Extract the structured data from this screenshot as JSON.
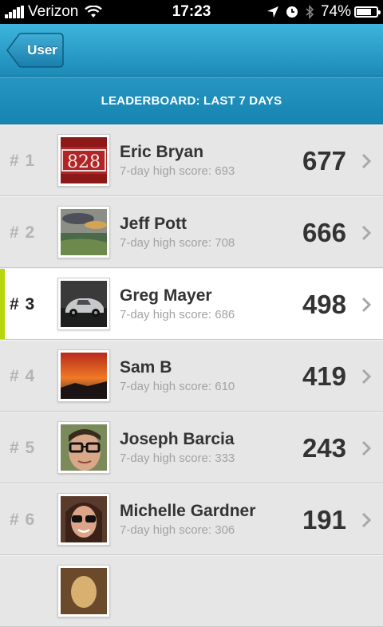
{
  "status_bar": {
    "carrier": "Verizon",
    "time": "17:23",
    "battery_percent": "74%",
    "battery_level": 0.74,
    "icons": [
      "signal-bars-icon",
      "wifi-icon",
      "location-arrow-icon",
      "alarm-clock-icon",
      "bluetooth-icon",
      "battery-icon"
    ]
  },
  "nav": {
    "back_label": "User"
  },
  "header": {
    "title": "LEADERBOARD: LAST 7 DAYS"
  },
  "colors": {
    "nav_blue": "#1c8ab7",
    "highlight": "#b6d80a",
    "row_bg": "#e6e6e6",
    "current_row_bg": "#ffffff"
  },
  "rows": [
    {
      "rank": "# 1",
      "name": "Eric Bryan",
      "subtext": "7-day high score: 693",
      "score": "677",
      "avatar": "car-plate-828",
      "current": false
    },
    {
      "rank": "# 2",
      "name": "Jeff Pott",
      "subtext": "7-day high score: 708",
      "score": "666",
      "avatar": "landscape-sunset",
      "current": false
    },
    {
      "rank": "# 3",
      "name": "Greg Mayer",
      "subtext": "7-day high score: 686",
      "score": "498",
      "avatar": "silver-sports-car",
      "current": true
    },
    {
      "rank": "# 4",
      "name": "Sam B",
      "subtext": "7-day high score: 610",
      "score": "419",
      "avatar": "orange-sky",
      "current": false
    },
    {
      "rank": "# 5",
      "name": "Joseph Barcia",
      "subtext": "7-day high score: 333",
      "score": "243",
      "avatar": "person-glasses",
      "current": false
    },
    {
      "rank": "# 6",
      "name": "Michelle Gardner",
      "subtext": "7-day high score: 306",
      "score": "191",
      "avatar": "person-sunglasses",
      "current": false
    }
  ]
}
